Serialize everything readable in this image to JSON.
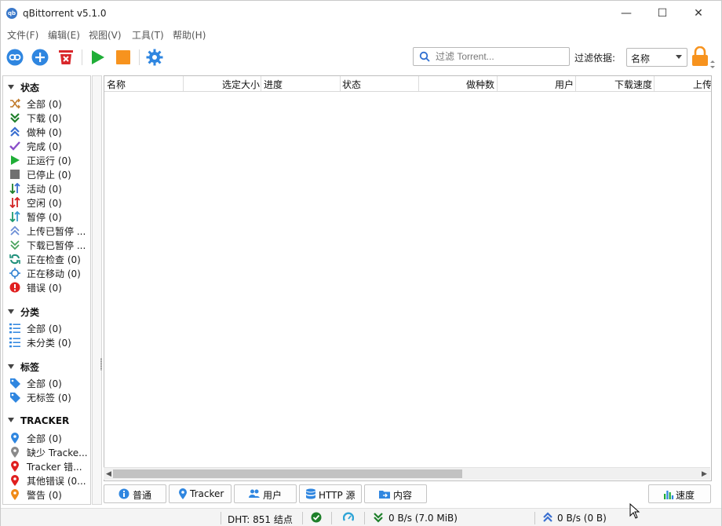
{
  "window": {
    "title": "qBittorrent v5.1.0",
    "icon_text": "qb",
    "controls": {
      "minimize": "—",
      "maximize": "☐",
      "close": "✕"
    }
  },
  "menu": [
    "文件(F)",
    "编辑(E)",
    "视图(V)",
    "工具(T)",
    "帮助(H)"
  ],
  "toolbar": {
    "search_placeholder": "过滤 Torrent...",
    "filter_label": "过滤依据:",
    "filter_value": "名称"
  },
  "sidebar": {
    "status": {
      "header": "状态",
      "items": [
        {
          "label": "全部 (0)",
          "icon": "shuffle-icon",
          "color": "#c07a2a"
        },
        {
          "label": "下载 (0)",
          "icon": "download-icon",
          "color": "#1e7f2a"
        },
        {
          "label": "做种 (0)",
          "icon": "upload-icon",
          "color": "#3a6fd0"
        },
        {
          "label": "完成 (0)",
          "icon": "check-icon",
          "color": "#8a4fc9"
        },
        {
          "label": "正运行 (0)",
          "icon": "play-icon",
          "color": "#1fae37"
        },
        {
          "label": "已停止 (0)",
          "icon": "stop-icon",
          "color": "#707070"
        },
        {
          "label": "活动 (0)",
          "icon": "active-arrows-icon",
          "color": "#1e7f2a"
        },
        {
          "label": "空闲 (0)",
          "icon": "inactive-arrows-icon",
          "color": "#d32424"
        },
        {
          "label": "暂停 (0)",
          "icon": "stalled-arrows-icon",
          "color": "#1e9a6e"
        },
        {
          "label": "上传已暂停 ...",
          "icon": "stalled-upload-icon",
          "color": "#6d8fd6"
        },
        {
          "label": "下载已暂停 ...",
          "icon": "stalled-download-icon",
          "color": "#4aa35d"
        },
        {
          "label": "正在检查 (0)",
          "icon": "refresh-icon",
          "color": "#1e8f7a"
        },
        {
          "label": "正在移动 (0)",
          "icon": "move-icon",
          "color": "#2c7fd0"
        },
        {
          "label": "错误 (0)",
          "icon": "error-icon",
          "color": "#e01f1f"
        }
      ]
    },
    "categories": {
      "header": "分类",
      "items": [
        {
          "label": "全部 (0)",
          "icon": "list-icon"
        },
        {
          "label": "未分类 (0)",
          "icon": "list-icon"
        }
      ]
    },
    "tags": {
      "header": "标签",
      "items": [
        {
          "label": "全部 (0)",
          "icon": "tag-icon"
        },
        {
          "label": "无标签 (0)",
          "icon": "tag-icon"
        }
      ]
    },
    "trackers": {
      "header": "TRACKER",
      "items": [
        {
          "label": "全部 (0)",
          "icon": "pin-icon",
          "color": "#2f86e0"
        },
        {
          "label": "缺少 Tracke...",
          "icon": "pin-icon",
          "color": "#8a8a8a"
        },
        {
          "label": "Tracker 错...",
          "icon": "pin-icon",
          "color": "#e01f1f"
        },
        {
          "label": "其他错误 (0...",
          "icon": "pin-icon",
          "color": "#e01f1f"
        },
        {
          "label": "警告 (0)",
          "icon": "pin-icon",
          "color": "#f08a17"
        }
      ]
    }
  },
  "table": {
    "columns": [
      "名称",
      "选定大小",
      "进度",
      "状态",
      "做种数",
      "用户",
      "下载速度",
      "上传"
    ]
  },
  "bottom_tabs": [
    "普通",
    "Tracker",
    "用户",
    "HTTP 源",
    "内容"
  ],
  "speed_button": "速度",
  "statusbar": {
    "dht": "DHT: 851 结点",
    "download": "0 B/s (7.0 MiB)",
    "upload": "0 B/s (0 B)"
  },
  "colors": {
    "accent_blue": "#2f86e0",
    "green": "#1fae37",
    "orange": "#f7931e",
    "red": "#d9262a"
  }
}
